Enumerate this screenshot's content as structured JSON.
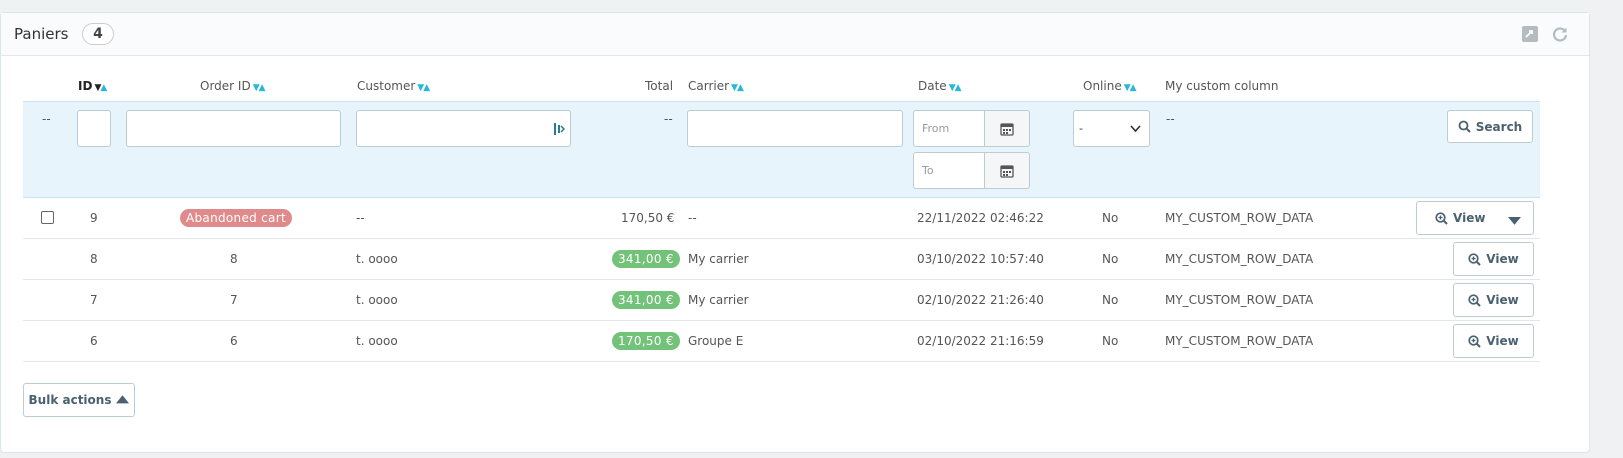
{
  "panel": {
    "title": "Paniers",
    "count": "4"
  },
  "columns": {
    "id": "ID",
    "order_id": "Order ID",
    "customer": "Customer",
    "total": "Total",
    "carrier": "Carrier",
    "date": "Date",
    "online": "Online",
    "custom": "My custom column"
  },
  "filters": {
    "empty": "--",
    "date_from_placeholder": "From",
    "date_to_placeholder": "To",
    "online_selected": "-",
    "search_label": "Search"
  },
  "rows": [
    {
      "id": "9",
      "order": "Abandoned cart",
      "order_status": "abandoned",
      "customer": "--",
      "total": "170,50 €",
      "total_highlight": false,
      "carrier": "--",
      "date": "22/11/2022 02:46:22",
      "online": "No",
      "custom": "MY_CUSTOM_ROW_DATA",
      "action": "View"
    },
    {
      "id": "8",
      "order": "8",
      "customer": "t. oooo",
      "total": "341,00 €",
      "total_highlight": true,
      "carrier": "My carrier",
      "date": "03/10/2022 10:57:40",
      "online": "No",
      "custom": "MY_CUSTOM_ROW_DATA",
      "action": "View"
    },
    {
      "id": "7",
      "order": "7",
      "customer": "t. oooo",
      "total": "341,00 €",
      "total_highlight": true,
      "carrier": "My carrier",
      "date": "02/10/2022 21:26:40",
      "online": "No",
      "custom": "MY_CUSTOM_ROW_DATA",
      "action": "View"
    },
    {
      "id": "6",
      "order": "6",
      "customer": "t. oooo",
      "total": "170,50 €",
      "total_highlight": true,
      "carrier": "Groupe E",
      "date": "02/10/2022 21:16:59",
      "online": "No",
      "custom": "MY_CUSTOM_ROW_DATA",
      "action": "View"
    }
  ],
  "bulk": {
    "label": "Bulk actions"
  },
  "colors": {
    "accent": "#25b9d7",
    "abandoned": "#e08a8c",
    "paid": "#72c279",
    "filter_bg": "#e8f4fb"
  },
  "icons": {
    "export": "export-icon",
    "refresh": "refresh-icon",
    "calendar": "calendar-icon",
    "search": "search-icon",
    "zoom": "zoom-in-icon",
    "caret": "caret-down-icon"
  }
}
